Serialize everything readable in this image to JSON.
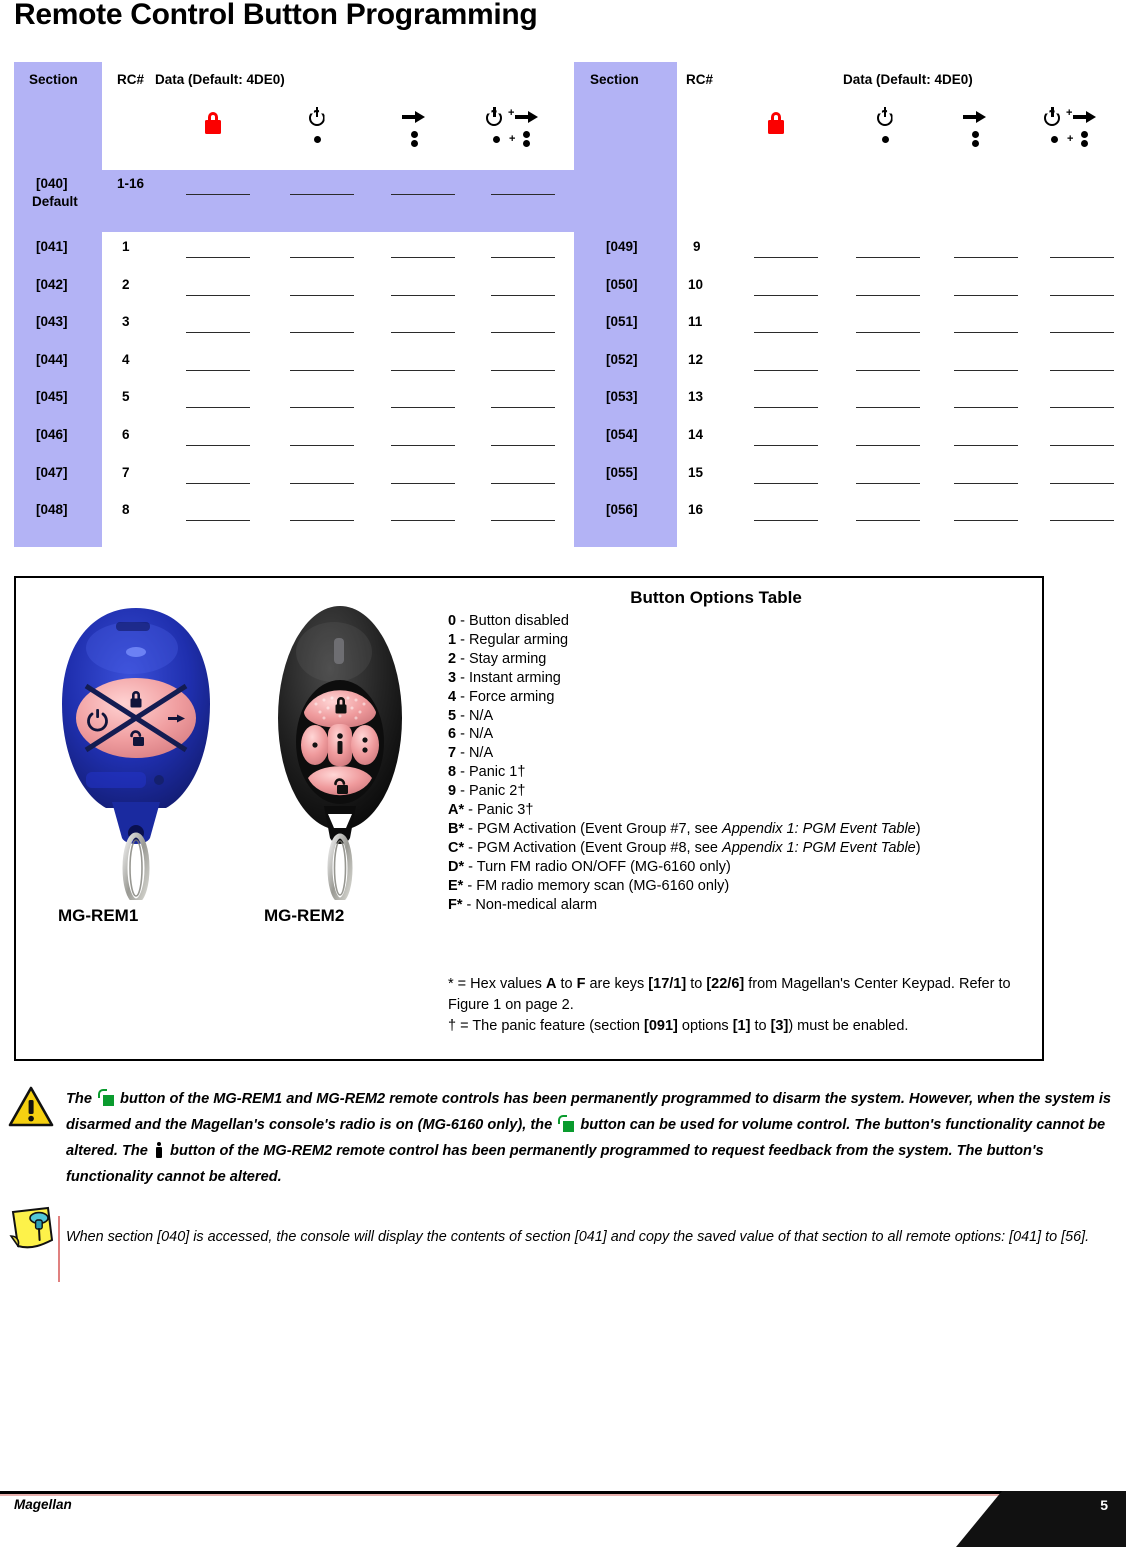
{
  "page_title": "Remote Control Button Programming",
  "table": {
    "headers": {
      "section": "Section",
      "rc": "RC#",
      "data": "Data (Default: 4DE0)"
    },
    "icon_columns": [
      {
        "name": "lock-red-icon",
        "label": "disarm (red lock)"
      },
      {
        "name": "power-dot-icon",
        "label": "power + 1 dot"
      },
      {
        "name": "arrow-dots-icon",
        "label": "arrow + 2 dots"
      },
      {
        "name": "power-plus-arrow-icon",
        "label": "power+dot plus arrow+2dots"
      }
    ],
    "default_row": {
      "section": "[040]",
      "section_sub": "Default",
      "rc": "1-16"
    },
    "left_rows": [
      {
        "section": "[041]",
        "rc": "1"
      },
      {
        "section": "[042]",
        "rc": "2"
      },
      {
        "section": "[043]",
        "rc": "3"
      },
      {
        "section": "[044]",
        "rc": "4"
      },
      {
        "section": "[045]",
        "rc": "5"
      },
      {
        "section": "[046]",
        "rc": "6"
      },
      {
        "section": "[047]",
        "rc": "7"
      },
      {
        "section": "[048]",
        "rc": "8"
      }
    ],
    "right_rows": [
      {
        "section": "[049]",
        "rc": "9"
      },
      {
        "section": "[050]",
        "rc": "10"
      },
      {
        "section": "[051]",
        "rc": "11"
      },
      {
        "section": "[052]",
        "rc": "12"
      },
      {
        "section": "[053]",
        "rc": "13"
      },
      {
        "section": "[054]",
        "rc": "14"
      },
      {
        "section": "[055]",
        "rc": "15"
      },
      {
        "section": "[056]",
        "rc": "16"
      }
    ]
  },
  "options_box": {
    "title": "Button Options Table",
    "options": [
      {
        "code": "0",
        "text": " - Button disabled"
      },
      {
        "code": "1",
        "text": " - Regular arming"
      },
      {
        "code": "2",
        "text": " - Stay arming"
      },
      {
        "code": "3",
        "text": " - Instant arming"
      },
      {
        "code": "4",
        "text": " - Force arming"
      },
      {
        "code": "5",
        "text": " - N/A"
      },
      {
        "code": "6",
        "text": " - N/A"
      },
      {
        "code": "7",
        "text": " - N/A"
      },
      {
        "code": "8",
        "text": " - Panic 1†"
      },
      {
        "code": "9",
        "text": " - Panic 2†"
      },
      {
        "code": "A*",
        "text": " - Panic 3†"
      },
      {
        "code": "B*",
        "text": " - PGM Activation (Event Group #7, see ",
        "italic": "Appendix 1: PGM Event Table",
        "tail": ")"
      },
      {
        "code": "C*",
        "text": " - PGM Activation (Event Group #8, see ",
        "italic": "Appendix 1: PGM Event Table",
        "tail": ")"
      },
      {
        "code": "D*",
        "text": " - Turn FM radio ON/OFF (MG-6160 only)"
      },
      {
        "code": "E*",
        "text": " - FM radio memory scan (MG-6160 only)"
      },
      {
        "code": "F*",
        "text": " - Non-medical alarm"
      }
    ],
    "footnote_star_1": "* = Hex values ",
    "footnote_star_a": "A",
    "footnote_star_2": " to ",
    "footnote_star_f": "F",
    "footnote_star_3": " are keys ",
    "footnote_star_k1": "[17/1]",
    "footnote_star_4": " to ",
    "footnote_star_k2": "[22/6]",
    "footnote_star_5": " from Magellan's Center Keypad. Refer to Figure 1 on page 2.",
    "footnote_dagger_1": "† = The panic feature (section ",
    "footnote_dagger_s": "[091]",
    "footnote_dagger_2": " options ",
    "footnote_dagger_o1": "[1]",
    "footnote_dagger_3": " to ",
    "footnote_dagger_o2": "[3]",
    "footnote_dagger_4": ") must be enabled.",
    "remote1_label": "MG-REM1",
    "remote2_label": "MG-REM2"
  },
  "notes": {
    "warning_p1": "The ",
    "warning_p2": " button of the MG-REM1 and MG-REM2 remote controls has been permanently programmed to disarm the system. However, when the system is disarmed and the Magellan's console's radio is on (MG-6160 only), the ",
    "warning_p3": " button can be used for volume control. The button's functionality cannot be altered. The ",
    "warning_p4": " button of the MG-REM2 remote control has been permanently programmed to request feedback from the system. The button's functionality cannot be altered.",
    "tip": "When section [040] is accessed, the console will display the contents of section [041] and copy the saved value of that section to all remote options: [041] to [56]."
  },
  "footer": {
    "product": "Magellan",
    "page_number": "5"
  },
  "colors": {
    "lavender": "#b3b3f5",
    "lock_red": "#fb0000",
    "lock_green": "#0a9b2e",
    "warn_yellow": "#f5d011",
    "note_yellow": "#fdf24a",
    "pin_teal": "#53c7d8"
  }
}
